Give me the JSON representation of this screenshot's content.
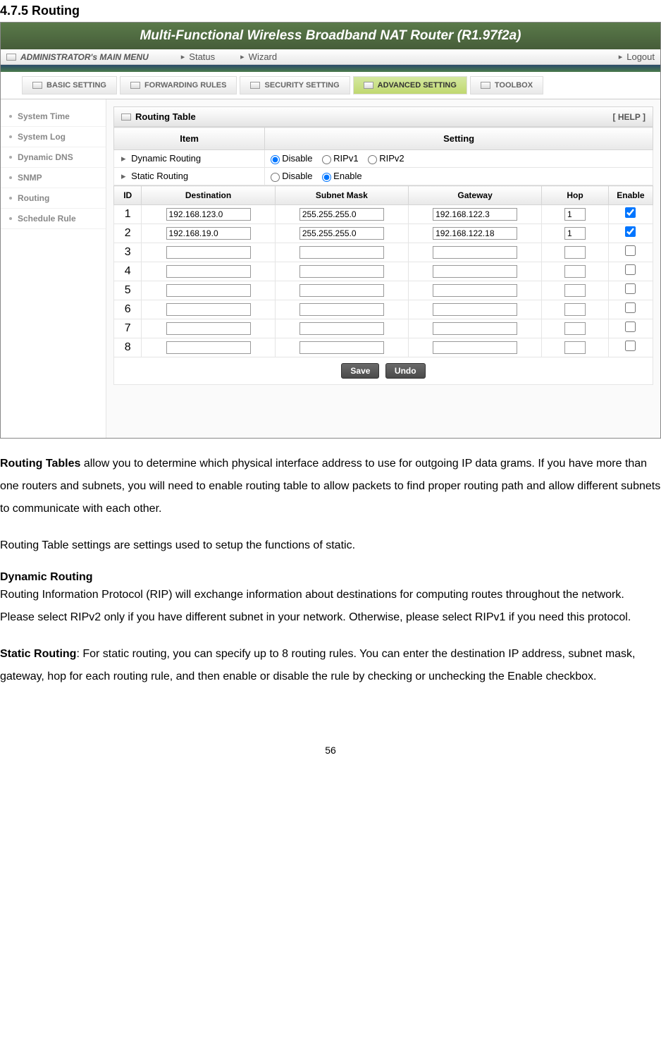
{
  "section_title": "4.7.5 Routing",
  "header_title": "Multi-Functional Wireless Broadband NAT Router (R1.97f2a)",
  "menu_bar": {
    "title": "ADMINISTRATOR's MAIN MENU",
    "status": "Status",
    "wizard": "Wizard",
    "logout": "Logout"
  },
  "tabs": {
    "basic": "BASIC SETTING",
    "forwarding": "FORWARDING RULES",
    "security": "SECURITY SETTING",
    "advanced": "ADVANCED SETTING",
    "toolbox": "TOOLBOX"
  },
  "sidebar": {
    "system_time": "System Time",
    "system_log": "System Log",
    "dynamic_dns": "Dynamic DNS",
    "snmp": "SNMP",
    "routing": "Routing",
    "schedule_rule": "Schedule Rule"
  },
  "panel": {
    "title": "Routing Table",
    "help": "[ HELP ]",
    "item_header": "Item",
    "setting_header": "Setting",
    "dynamic_routing_label": "Dynamic Routing",
    "static_routing_label": "Static Routing",
    "disable": "Disable",
    "ripv1": "RIPv1",
    "ripv2": "RIPv2",
    "enable": "Enable"
  },
  "route_headers": {
    "id": "ID",
    "destination": "Destination",
    "subnet_mask": "Subnet Mask",
    "gateway": "Gateway",
    "hop": "Hop",
    "enable": "Enable"
  },
  "routes": [
    {
      "id": "1",
      "destination": "192.168.123.0",
      "subnet_mask": "255.255.255.0",
      "gateway": "192.168.122.3",
      "hop": "1",
      "enabled": true
    },
    {
      "id": "2",
      "destination": "192.168.19.0",
      "subnet_mask": "255.255.255.0",
      "gateway": "192.168.122.18",
      "hop": "1",
      "enabled": true
    },
    {
      "id": "3",
      "destination": "",
      "subnet_mask": "",
      "gateway": "",
      "hop": "",
      "enabled": false
    },
    {
      "id": "4",
      "destination": "",
      "subnet_mask": "",
      "gateway": "",
      "hop": "",
      "enabled": false
    },
    {
      "id": "5",
      "destination": "",
      "subnet_mask": "",
      "gateway": "",
      "hop": "",
      "enabled": false
    },
    {
      "id": "6",
      "destination": "",
      "subnet_mask": "",
      "gateway": "",
      "hop": "",
      "enabled": false
    },
    {
      "id": "7",
      "destination": "",
      "subnet_mask": "",
      "gateway": "",
      "hop": "",
      "enabled": false
    },
    {
      "id": "8",
      "destination": "",
      "subnet_mask": "",
      "gateway": "",
      "hop": "",
      "enabled": false
    }
  ],
  "buttons": {
    "save": "Save",
    "undo": "Undo"
  },
  "doc_text": {
    "para1_bold": "Routing Tables",
    "para1": " allow you to determine which physical interface address to use for outgoing IP data grams. If you have more than one routers and subnets, you will need to enable routing table to allow packets to find proper routing path and allow different subnets to communicate with each other.",
    "para2": "Routing Table settings are settings used to setup the functions of static.",
    "dynamic_title": "Dynamic Routing",
    "para3": "Routing Information Protocol (RIP) will exchange information about destinations for computing routes throughout the network. Please select RIPv2 only if you have different subnet in your network. Otherwise, please select RIPv1 if you need this protocol.",
    "static_bold": "Static Routing",
    "para4": ": For static routing, you can specify up to 8 routing rules. You can enter the destination IP address, subnet mask, gateway, hop for each routing rule, and then enable or disable the rule by checking or unchecking the Enable checkbox."
  },
  "page_number": "56"
}
